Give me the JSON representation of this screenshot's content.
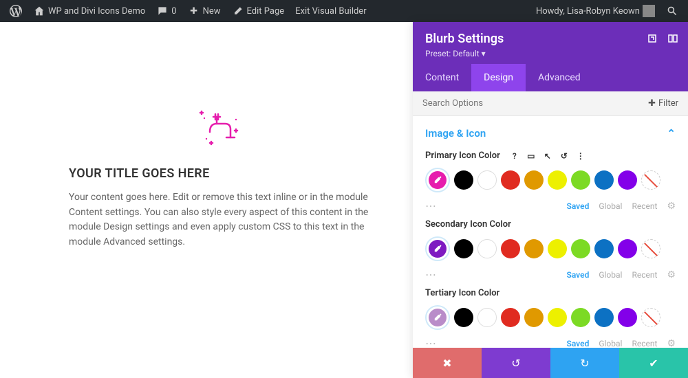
{
  "adminbar": {
    "site_title": "WP and Divi Icons Demo",
    "comment_count": "0",
    "new": "New",
    "edit_page": "Edit Page",
    "exit_visual_builder": "Exit Visual Builder",
    "howdy": "Howdy, Lisa-Robyn Keown"
  },
  "blurb": {
    "title": "YOUR TITLE GOES HERE",
    "body": "Your content goes here. Edit or remove this text inline or in the module Content settings. You can also style every aspect of this content in the module Design settings and even apply custom CSS to this text in the module Advanced settings."
  },
  "panel": {
    "title": "Blurb Settings",
    "preset": "Preset: Default ▾",
    "tabs": {
      "content": "Content",
      "design": "Design",
      "advanced": "Advanced"
    },
    "search_placeholder": "Search Options",
    "filter": "Filter",
    "section": "Image & Icon",
    "footer": {
      "saved": "Saved",
      "global": "Global",
      "recent": "Recent"
    },
    "options": [
      {
        "label": "Primary Icon Color",
        "eyedrop": "#e61ead"
      },
      {
        "label": "Secondary Icon Color",
        "eyedrop": "#7e1ac1"
      },
      {
        "label": "Tertiary Icon Color",
        "eyedrop": "#b98cc9"
      }
    ],
    "palette": [
      "#000000",
      "#ffffff",
      "#e02b20",
      "#e09900",
      "#edf000",
      "#7cda24",
      "#0c71c3",
      "#8300e9"
    ]
  }
}
